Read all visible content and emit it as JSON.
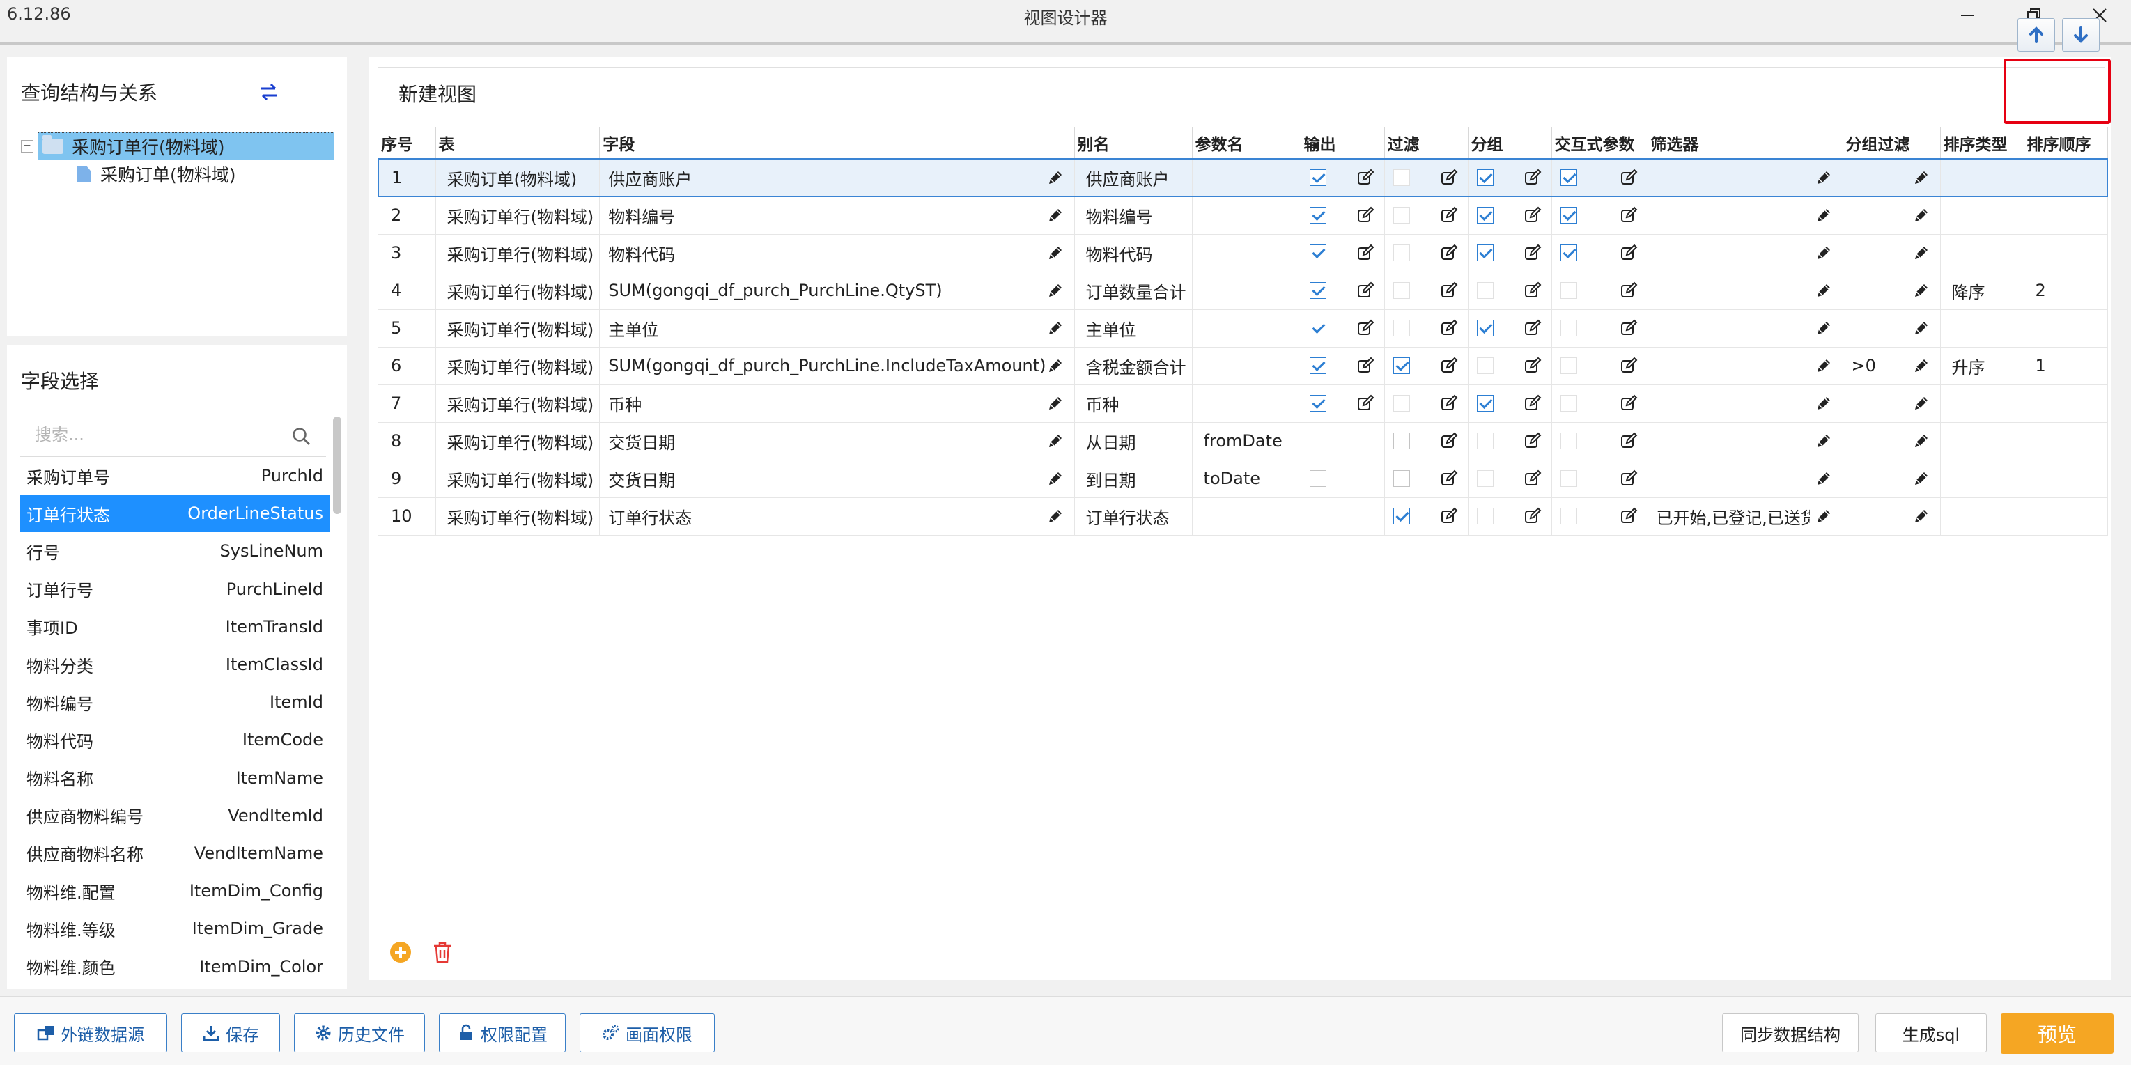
{
  "window": {
    "version": "6.12.86",
    "title": "视图设计器"
  },
  "query_panel": {
    "title": "查询结构与关系",
    "tree": {
      "root_label": "采购订单行(物料域)",
      "child_label": "采购订单(物料域)"
    }
  },
  "fields_panel": {
    "title": "字段选择",
    "search_placeholder": "搜索...",
    "items": [
      {
        "label": "采购订单号",
        "code": "PurchId"
      },
      {
        "label": "订单行状态",
        "code": "OrderLineStatus"
      },
      {
        "label": "行号",
        "code": "SysLineNum"
      },
      {
        "label": "订单行号",
        "code": "PurchLineId"
      },
      {
        "label": "事项ID",
        "code": "ItemTransId"
      },
      {
        "label": "物料分类",
        "code": "ItemClassId"
      },
      {
        "label": "物料编号",
        "code": "ItemId"
      },
      {
        "label": "物料代码",
        "code": "ItemCode"
      },
      {
        "label": "物料名称",
        "code": "ItemName"
      },
      {
        "label": "供应商物料编号",
        "code": "VendItemId"
      },
      {
        "label": "供应商物料名称",
        "code": "VendItemName"
      },
      {
        "label": "物料维.配置",
        "code": "ItemDim_Config"
      },
      {
        "label": "物料维.等级",
        "code": "ItemDim_Grade"
      },
      {
        "label": "物料维.颜色",
        "code": "ItemDim_Color"
      }
    ]
  },
  "view": {
    "title": "新建视图",
    "columns": {
      "seq": "序号",
      "table": "表",
      "field": "字段",
      "alias": "别名",
      "param": "参数名",
      "output": "输出",
      "filter": "过滤",
      "group": "分组",
      "interactive": "交互式参数",
      "selector": "筛选器",
      "group_filter": "分组过滤",
      "sort_type": "排序类型",
      "sort_order": "排序顺序"
    },
    "rows": [
      {
        "seq": "1",
        "table": "采购订单(物料域)",
        "field": "供应商账户",
        "alias": "供应商账户",
        "param": "",
        "output": true,
        "filter": false,
        "group": true,
        "interactive": true,
        "selector": "",
        "group_filter": "",
        "sort_type": "",
        "sort_order": ""
      },
      {
        "seq": "2",
        "table": "采购订单行(物料域)",
        "field": "物料编号",
        "alias": "物料编号",
        "param": "",
        "output": true,
        "filter": false,
        "group": true,
        "interactive": true,
        "selector": "",
        "group_filter": "",
        "sort_type": "",
        "sort_order": ""
      },
      {
        "seq": "3",
        "table": "采购订单行(物料域)",
        "field": "物料代码",
        "alias": "物料代码",
        "param": "",
        "output": true,
        "filter": false,
        "group": true,
        "interactive": true,
        "selector": "",
        "group_filter": "",
        "sort_type": "",
        "sort_order": ""
      },
      {
        "seq": "4",
        "table": "采购订单行(物料域)",
        "field": "SUM(gongqi_df_purch_PurchLine.QtyST)",
        "alias": "订单数量合计",
        "param": "",
        "output": true,
        "filter": false,
        "group": false,
        "interactive": false,
        "selector": "",
        "group_filter": "",
        "sort_type": "降序",
        "sort_order": "2"
      },
      {
        "seq": "5",
        "table": "采购订单行(物料域)",
        "field": "主单位",
        "alias": "主单位",
        "param": "",
        "output": true,
        "filter": false,
        "group": true,
        "interactive": false,
        "selector": "",
        "group_filter": "",
        "sort_type": "",
        "sort_order": ""
      },
      {
        "seq": "6",
        "table": "采购订单行(物料域)",
        "field": "SUM(gongqi_df_purch_PurchLine.IncludeTaxAmount)",
        "alias": "含税金额合计",
        "param": "",
        "output": true,
        "filter": true,
        "group": false,
        "interactive": false,
        "selector": "",
        "group_filter": ">0",
        "sort_type": "升序",
        "sort_order": "1"
      },
      {
        "seq": "7",
        "table": "采购订单行(物料域)",
        "field": "币种",
        "alias": "币种",
        "param": "",
        "output": true,
        "filter": false,
        "group": true,
        "interactive": false,
        "selector": "",
        "group_filter": "",
        "sort_type": "",
        "sort_order": ""
      },
      {
        "seq": "8",
        "table": "采购订单行(物料域)",
        "field": "交货日期",
        "alias": "从日期",
        "param": "fromDate",
        "output": false,
        "filter": false,
        "group": false,
        "interactive": false,
        "selector": "",
        "group_filter": "",
        "sort_type": "",
        "sort_order": ""
      },
      {
        "seq": "9",
        "table": "采购订单行(物料域)",
        "field": "交货日期",
        "alias": "到日期",
        "param": "toDate",
        "output": false,
        "filter": false,
        "group": false,
        "interactive": false,
        "selector": "",
        "group_filter": "",
        "sort_type": "",
        "sort_order": ""
      },
      {
        "seq": "10",
        "table": "采购订单行(物料域)",
        "field": "订单行状态",
        "alias": "订单行状态",
        "param": "",
        "output": false,
        "filter": true,
        "group": false,
        "interactive": false,
        "selector": "已开始,已登记,已送货",
        "group_filter": "",
        "sort_type": "",
        "sort_order": ""
      }
    ]
  },
  "bottom_bar": {
    "external_source": "外链数据源",
    "save": "保存",
    "history": "历史文件",
    "permission_config": "权限配置",
    "screen_permission": "画面权限",
    "sync_structure": "同步数据结构",
    "generate_sql": "生成sql",
    "preview": "预览"
  },
  "colors": {
    "accent_blue": "#1e90ff",
    "checkbox_blue": "#2d7fd3",
    "preview_orange": "#f5a623",
    "highlight_red": "#e60012",
    "plus_icon": "#f5a623",
    "trash_icon": "#e53935"
  }
}
